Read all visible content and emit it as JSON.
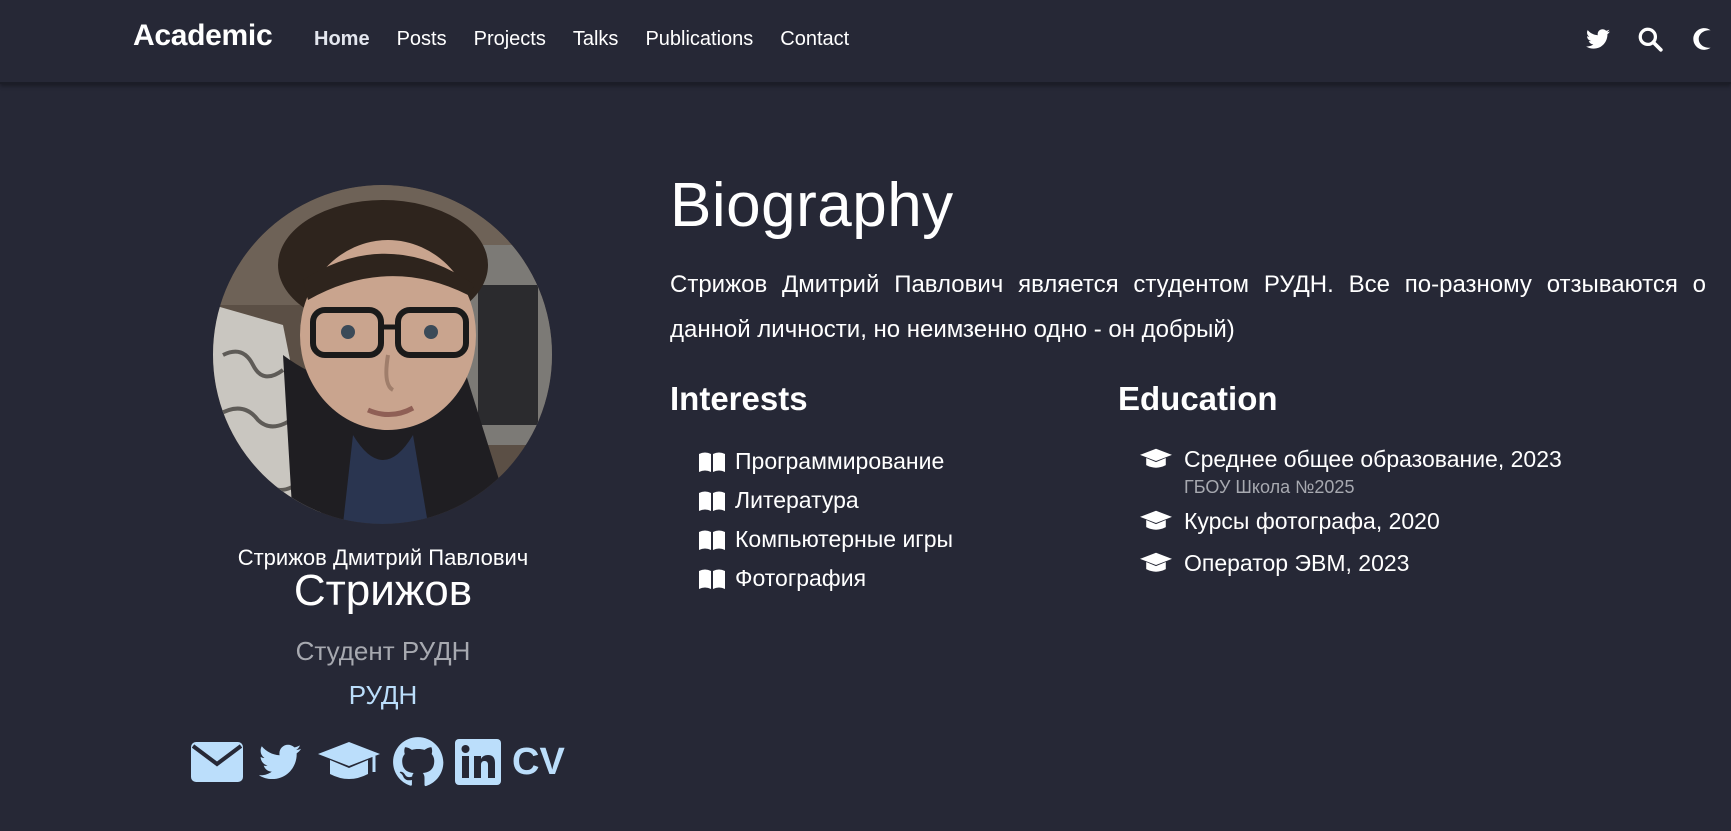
{
  "navbar": {
    "brand": "Academic",
    "links": [
      {
        "label": "Home",
        "active": true
      },
      {
        "label": "Posts"
      },
      {
        "label": "Projects"
      },
      {
        "label": "Talks"
      },
      {
        "label": "Publications"
      },
      {
        "label": "Contact"
      }
    ],
    "icons": [
      "twitter-icon",
      "search-icon",
      "moon-icon"
    ]
  },
  "profile": {
    "full_name": "Стрижов Дмитрий Павлович",
    "display_name": "Стрижов",
    "role": "Студент РУДН",
    "organization": "РУДН",
    "social": [
      "envelope-icon",
      "twitter-icon",
      "graduation-cap-icon",
      "github-icon",
      "linkedin-icon",
      "cv-icon"
    ],
    "cv_label": "CV"
  },
  "biography": {
    "title": "Biography",
    "text": "Стрижов Дмитрий Павлович является студентом РУДН. Все по-разному отзываются о данной личности, но неимзенно одно - он добрый)"
  },
  "interests": {
    "title": "Interests",
    "items": [
      "Программирование",
      "Литература",
      "Компьютерные игры",
      "Фотография"
    ]
  },
  "education": {
    "title": "Education",
    "items": [
      {
        "course": "Среднее общее образование, 2023",
        "institution": "ГБОУ Школа №2025"
      },
      {
        "course": "Курсы фотографа, 2020",
        "institution": ""
      },
      {
        "course": "Оператор ЭВМ, 2023",
        "institution": ""
      }
    ]
  },
  "colors": {
    "background": "#262836",
    "accent_link": "#bbdefb",
    "muted_text": "#a7a9b0",
    "text": "#ffffff"
  }
}
